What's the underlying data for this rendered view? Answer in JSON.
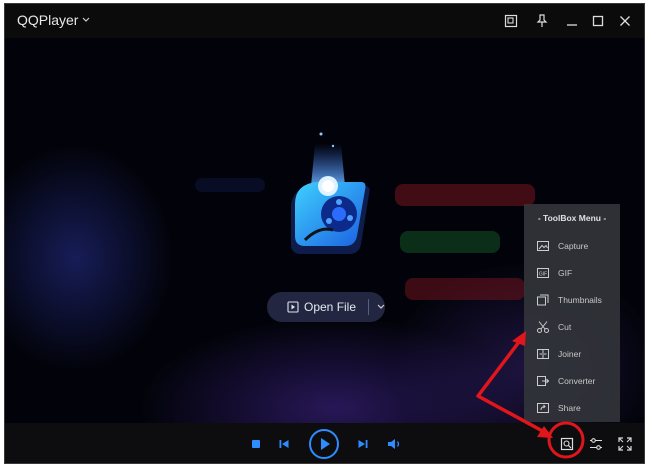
{
  "app": {
    "title": "QQPlayer"
  },
  "open_file": {
    "label": "Open File"
  },
  "toolbox": {
    "title": "- ToolBox Menu -",
    "items": [
      {
        "label": "Capture",
        "icon": "capture-icon"
      },
      {
        "label": "GIF",
        "icon": "gif-icon"
      },
      {
        "label": "Thumbnails",
        "icon": "thumbnails-icon"
      },
      {
        "label": "Cut",
        "icon": "scissors-icon"
      },
      {
        "label": "Joiner",
        "icon": "joiner-icon"
      },
      {
        "label": "Converter",
        "icon": "converter-icon"
      },
      {
        "label": "Share",
        "icon": "share-icon"
      }
    ]
  },
  "colors": {
    "accent": "#2d8cff",
    "titlebar": "#0b0b0c",
    "annotation": "#e0161b"
  }
}
